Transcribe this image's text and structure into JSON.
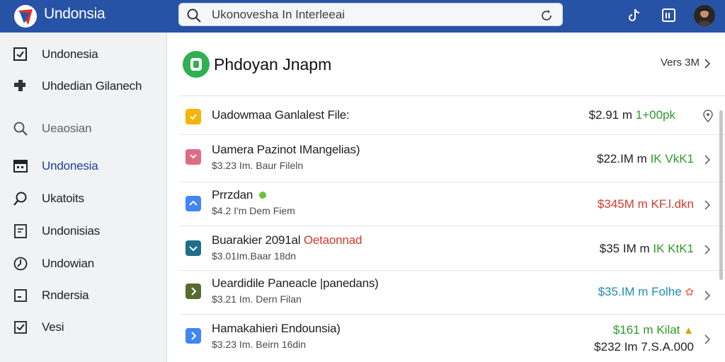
{
  "app": {
    "title": "Undonsia"
  },
  "search": {
    "value": "Ukonovesha In Interleeai"
  },
  "sidebar": {
    "items": [
      {
        "label": "Undonesia",
        "icon": "checkbox-icon"
      },
      {
        "label": "Uhdedian Gilanech",
        "icon": "puzzle-icon"
      },
      {
        "label": "Ueaosian",
        "icon": "search-icon"
      },
      {
        "label": "Undonesia",
        "icon": "calendar-icon"
      },
      {
        "label": "Ukatoits",
        "icon": "magnifier-icon"
      },
      {
        "label": "Undonisias",
        "icon": "document-icon"
      },
      {
        "label": "Undowian",
        "icon": "clock-icon"
      },
      {
        "label": "Rndersia",
        "icon": "minus-box-icon"
      },
      {
        "label": "Vesi",
        "icon": "check-box-icon"
      }
    ]
  },
  "main": {
    "title": "Phdoyan Jnapm",
    "views": "Vers 3M"
  },
  "rows": [
    {
      "title": "Uadowmaa Ganlalest File:",
      "sub": "",
      "price": "$2.91 m",
      "change": "1+00pk",
      "change_color": "#2f9a2a",
      "badge_color": "#f4b400",
      "icon": "pin-icon"
    },
    {
      "title": "Uamera Pazinot IMangelias)",
      "sub": "$3.23 Im. Baur Fileln",
      "price": "$22.IM m",
      "change": "IK VkK1",
      "change_color": "#2f9a2a",
      "badge_color": "#e06c83",
      "icon": "chevron-right-icon"
    },
    {
      "title": "Prrzdan",
      "sub": "$4.2 I'm Dem Fiem",
      "price": "$345M m",
      "change": "KF.l.dkn",
      "change_color": "#d23b2a",
      "badge_color": "#4285f4",
      "icon": "chevron-right-icon"
    },
    {
      "title": "Buarakier 2091al",
      "title_extra": "Oetaonnad",
      "sub": "$3.01Im.Baar 18dn",
      "price": "$35 IM m",
      "change": "IK KtK1",
      "change_color": "#2f9a2a",
      "badge_color": "#1f6e8c",
      "icon": "chevron-right-icon"
    },
    {
      "title": "Ueardidile Paneacle |panedans)",
      "sub": "$3.21 Im. Dern Filan",
      "price": "$35.IM m",
      "change": "Folhe",
      "change_color": "#1e8cb0",
      "badge_color": "#556b2f",
      "icon": "chevron-right-icon"
    },
    {
      "title": "Hamakahieri Endounsia)",
      "sub": "$3.23 Im. Beirn 16din",
      "price": "$161 m",
      "change": "Kilat",
      "change_color": "#2f9a2a",
      "price2": "$232 Im",
      "change2": "7.S.A.000",
      "badge_color": "#4285f4",
      "icon": "chevron-right-icon"
    }
  ],
  "colors": {
    "topbar": "#2753a6",
    "accent_green": "#2fb052"
  }
}
